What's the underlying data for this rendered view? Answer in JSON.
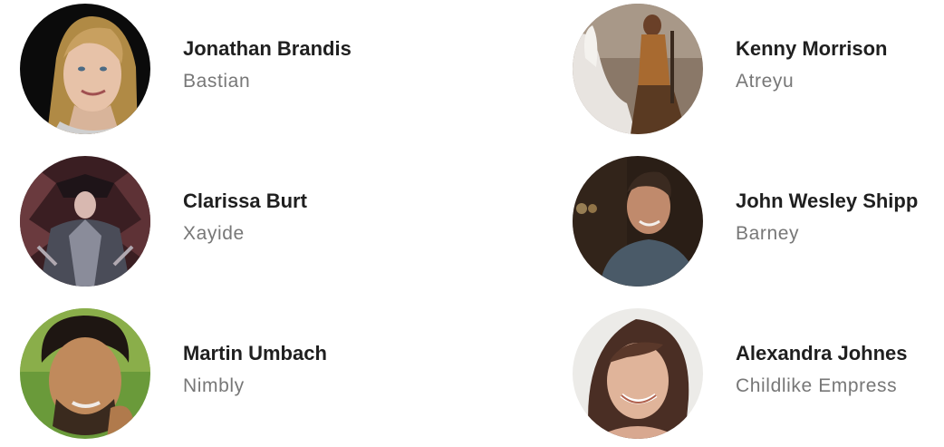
{
  "cast": [
    {
      "actor": "Jonathan Brandis",
      "character": "Bastian",
      "photo": "headshot-blond-hair"
    },
    {
      "actor": "Kenny Morrison",
      "character": "Atreyu",
      "photo": "rider-on-white-horse"
    },
    {
      "actor": "Clarissa Burt",
      "character": "Xayide",
      "photo": "costume-dark-sorceress"
    },
    {
      "actor": "John Wesley Shipp",
      "character": "Barney",
      "photo": "man-smiling-indoors"
    },
    {
      "actor": "Martin Umbach",
      "character": "Nimbly",
      "photo": "man-curly-hair-beard"
    },
    {
      "actor": "Alexandra Johnes",
      "character": "Childlike Empress",
      "photo": "woman-smiling"
    }
  ]
}
